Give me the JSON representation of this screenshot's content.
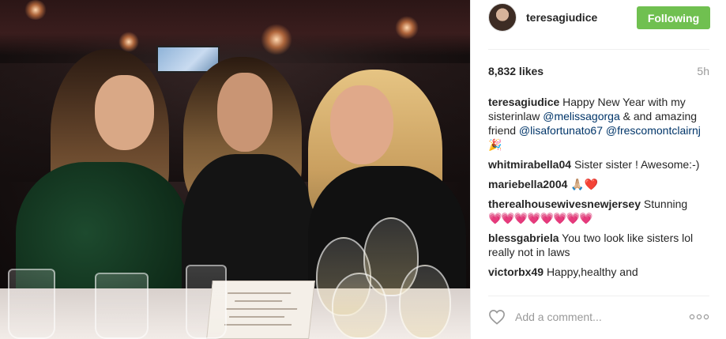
{
  "post": {
    "username": "teresagiudice",
    "follow_label": "Following",
    "likes": "8,832 likes",
    "time": "5h"
  },
  "caption": {
    "user": "teresagiudice",
    "text_1": "Happy New Year with my sisterinlaw ",
    "mention_1": "@melissagorga",
    "text_2": " & and amazing friend ",
    "mention_2": "@lisafortunato67",
    "mention_3": "@frescomontclairnj",
    "emoji": "🎉"
  },
  "comments": [
    {
      "user": "whitmirabella04",
      "text": "Sister sister ! Awesome:-)"
    },
    {
      "user": "mariebella2004",
      "text": "🙏🏼❤️"
    },
    {
      "user": "therealhousewivesnewjersey",
      "text": "Stunning",
      "emoji": "💗💗💗💗💗💗💗💗"
    },
    {
      "user": "blessgabriela",
      "text": "You two look like sisters lol really not in laws"
    },
    {
      "user": "victorbx49",
      "text": "Happy,healthy and"
    }
  ],
  "comment_box": {
    "placeholder": "Add a comment...",
    "like_icon": "heart-outline-icon",
    "more_icon": "more-options-icon"
  },
  "colors": {
    "follow_green": "#70c050",
    "mention_blue": "#003569",
    "muted_gray": "#999999"
  }
}
